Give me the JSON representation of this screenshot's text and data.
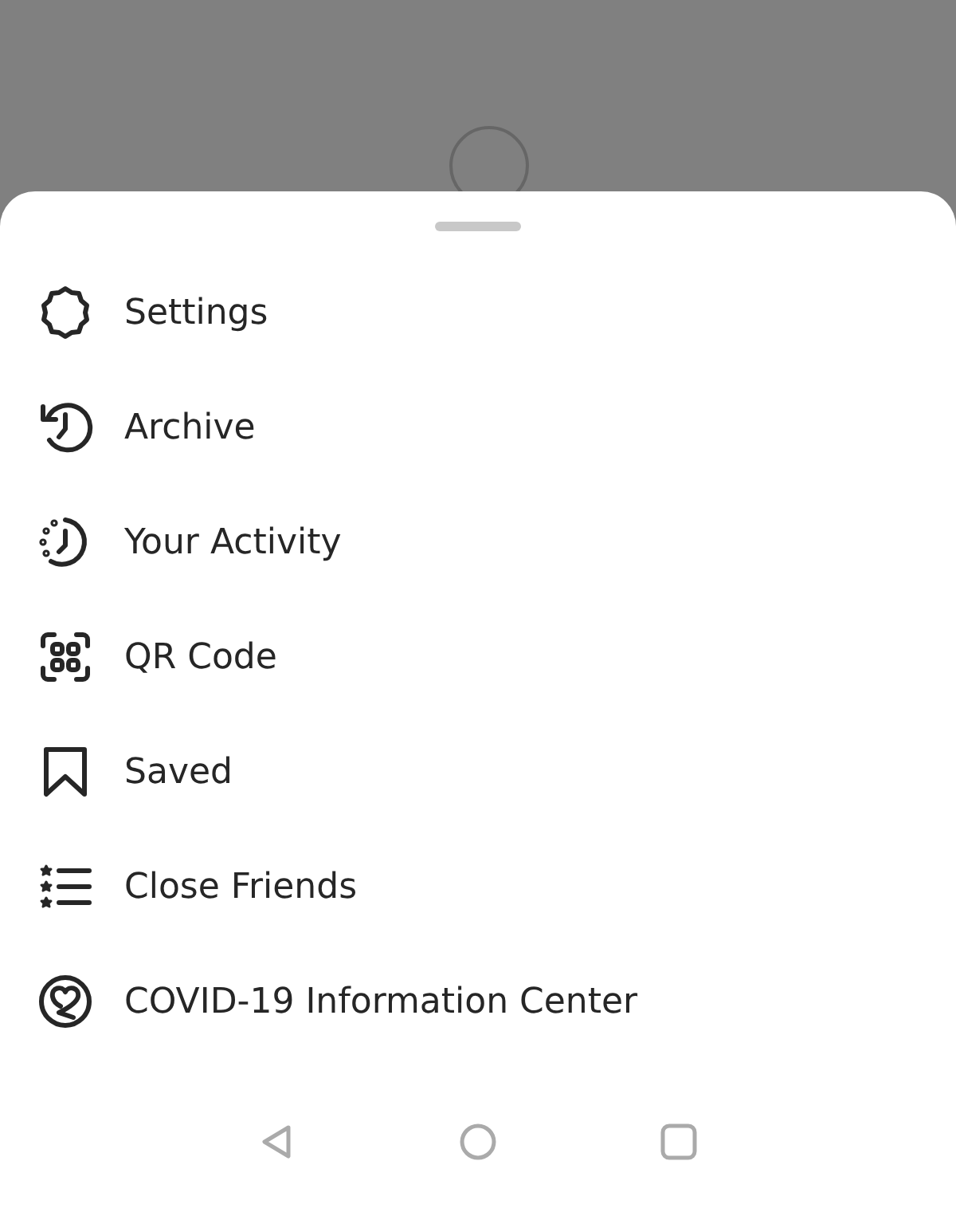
{
  "menu": {
    "items": [
      {
        "label": "Settings"
      },
      {
        "label": "Archive"
      },
      {
        "label": "Your Activity"
      },
      {
        "label": "QR Code"
      },
      {
        "label": "Saved"
      },
      {
        "label": "Close Friends"
      },
      {
        "label": "COVID-19 Information Center"
      }
    ]
  }
}
